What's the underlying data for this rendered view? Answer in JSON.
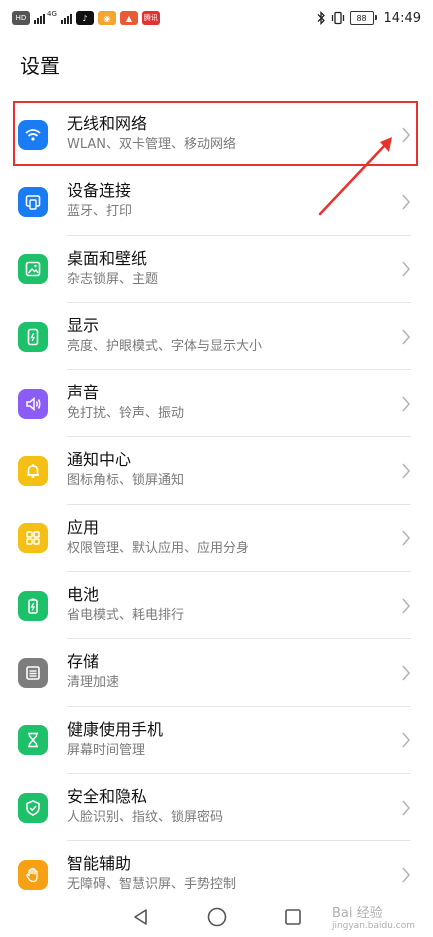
{
  "status_bar": {
    "left_chips": [
      "HD",
      "",
      "",
      "",
      "腾讯"
    ],
    "network": "4G",
    "battery": "88",
    "time": "14:49"
  },
  "page": {
    "title": "设置"
  },
  "settings": [
    {
      "title": "无线和网络",
      "subtitle": "WLAN、双卡管理、移动网络",
      "icon": "wifi-icon",
      "color": "#1a7cf2"
    },
    {
      "title": "设备连接",
      "subtitle": "蓝牙、打印",
      "icon": "device-connect-icon",
      "color": "#1a7cf2"
    },
    {
      "title": "桌面和壁纸",
      "subtitle": "杂志锁屏、主题",
      "icon": "wallpaper-icon",
      "color": "#1ec06a"
    },
    {
      "title": "显示",
      "subtitle": "亮度、护眼模式、字体与显示大小",
      "icon": "display-icon",
      "color": "#1ec06a"
    },
    {
      "title": "声音",
      "subtitle": "免打扰、铃声、振动",
      "icon": "sound-icon",
      "color": "#8b5cf6"
    },
    {
      "title": "通知中心",
      "subtitle": "图标角标、锁屏通知",
      "icon": "bell-icon",
      "color": "#f5c016"
    },
    {
      "title": "应用",
      "subtitle": "权限管理、默认应用、应用分身",
      "icon": "apps-icon",
      "color": "#f5c016"
    },
    {
      "title": "电池",
      "subtitle": "省电模式、耗电排行",
      "icon": "battery-icon",
      "color": "#1ec06a"
    },
    {
      "title": "存储",
      "subtitle": "清理加速",
      "icon": "storage-icon",
      "color": "#7d7d7d"
    },
    {
      "title": "健康使用手机",
      "subtitle": "屏幕时间管理",
      "icon": "hourglass-icon",
      "color": "#1ec06a"
    },
    {
      "title": "安全和隐私",
      "subtitle": "人脸识别、指纹、锁屏密码",
      "icon": "shield-icon",
      "color": "#1ec06a"
    },
    {
      "title": "智能辅助",
      "subtitle": "无障碍、智慧识屏、手势控制",
      "icon": "hand-icon",
      "color": "#f5a113"
    }
  ],
  "annotation": {
    "highlight_color": "#e8322d"
  },
  "watermark": {
    "text": "Bai 经验",
    "small": "jingyan.baidu.com"
  }
}
